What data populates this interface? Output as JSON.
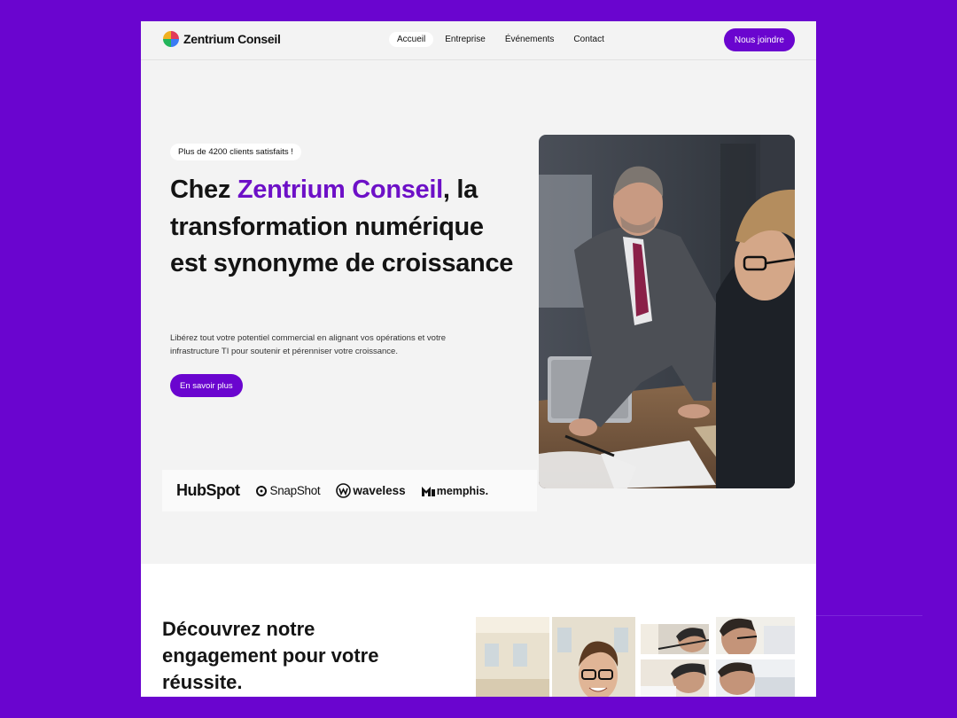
{
  "brand": {
    "name": "Zentrium Conseil"
  },
  "nav": {
    "items": [
      {
        "label": "Accueil",
        "active": true
      },
      {
        "label": "Entreprise",
        "active": false
      },
      {
        "label": "Événements",
        "active": false
      },
      {
        "label": "Contact",
        "active": false
      }
    ],
    "join_label": "Nous joindre"
  },
  "hero": {
    "badge": "Plus de 4200 clients satisfaits !",
    "title_prefix": "Chez ",
    "title_accent": "Zentrium Conseil",
    "title_suffix": ", la transformation numérique est synonyme de croissance",
    "description": "Libérez tout votre potentiel commercial en alignant vos opérations et votre infrastructure TI pour soutenir et pérenniser votre croissance.",
    "cta_label": "En savoir plus"
  },
  "partners": {
    "hubspot": "HubSpot",
    "snapshot": "SnapShot",
    "waveless": "waveless",
    "memphis": "memphis."
  },
  "section2": {
    "title": "Découvrez notre engagement pour votre réussite."
  },
  "colors": {
    "brand": "#6a05cf",
    "accent_text": "#6d10c7",
    "page_bg": "#f3f3f3"
  }
}
